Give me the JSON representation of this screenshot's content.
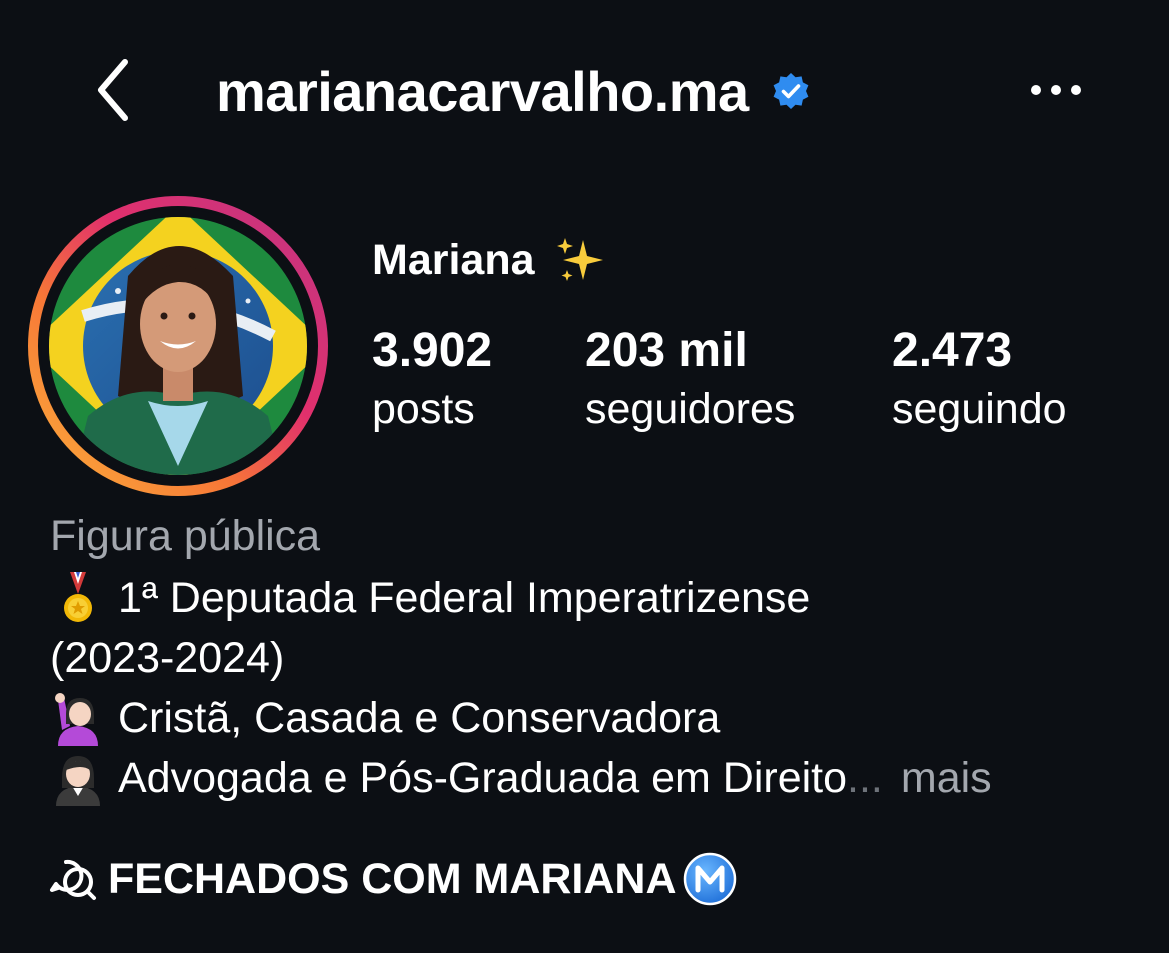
{
  "header": {
    "username": "marianacarvalho.ma",
    "verified": true,
    "back_icon": "chevron-left-icon",
    "more_icon": "ellipsis-horizontal-icon"
  },
  "profile": {
    "display_name": "Mariana",
    "name_emoji": "sparkles-icon",
    "avatar": "profile-photo-with-story-ring",
    "story_ring_colors": [
      "#f9ce34",
      "#ee2a7b",
      "#d62976"
    ]
  },
  "stats": [
    {
      "value": "3.902",
      "label": "posts"
    },
    {
      "value": "203 mil",
      "label": "seguidores"
    },
    {
      "value": "2.473",
      "label": "seguindo"
    }
  ],
  "bio": {
    "category": "Figura pública",
    "lines": [
      {
        "icon": "medal-icon",
        "text": "1ª Deputada Federal Imperatrizense"
      },
      {
        "icon": "",
        "text": "(2023-2024)"
      },
      {
        "icon": "woman-raising-hand-icon",
        "text": "Cristã, Casada e Conservadora"
      },
      {
        "icon": "woman-icon",
        "text": "Advogada e Pós-Graduada em Direito"
      }
    ],
    "ellipsis": "...",
    "more_label": "mais"
  },
  "channel": {
    "icon": "broadcast-chat-icon",
    "label": "FECHADOS COM MARIANA",
    "badge_icon": "m-circle-icon"
  },
  "colors": {
    "background": "#0c0f14",
    "text": "#ffffff",
    "muted": "#a3a7ae",
    "verified_blue": "#2f8cf0"
  }
}
